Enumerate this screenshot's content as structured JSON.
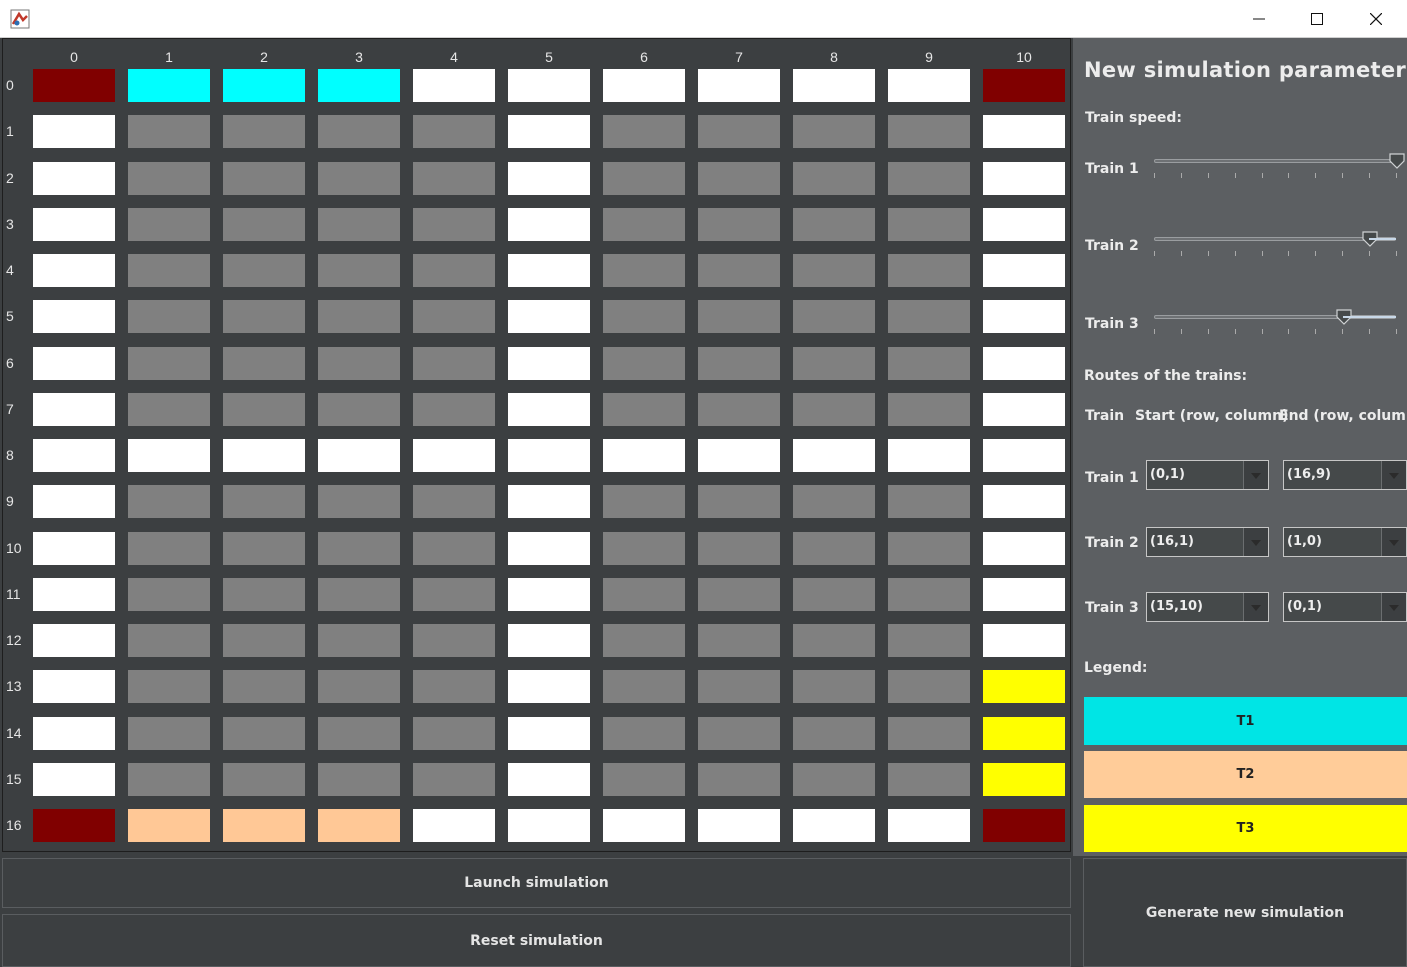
{
  "window": {
    "app_icon": "java-app-icon",
    "minimize_icon": "minimize-icon",
    "maximize_icon": "maximize-icon",
    "close_icon": "close-icon"
  },
  "grid": {
    "columns": [
      "0",
      "1",
      "2",
      "3",
      "4",
      "5",
      "6",
      "7",
      "8",
      "9",
      "10"
    ],
    "rows": [
      "0",
      "1",
      "2",
      "3",
      "4",
      "5",
      "6",
      "7",
      "8",
      "9",
      "10",
      "11",
      "12",
      "13",
      "14",
      "15",
      "16"
    ],
    "colors": {
      "W": "#ffffff",
      "G": "#808080",
      "R": "#800000",
      "C": "#00ffff",
      "P": "#ffc896",
      "Y": "#ffff00"
    },
    "cells": [
      "RCCCWWWWWWR",
      "WGGGGWGGGGW",
      "WGGGGWGGGGW",
      "WGGGGWGGGGW",
      "WGGGGWGGGGW",
      "WGGGGWGGGGW",
      "WGGGGWGGGGW",
      "WGGGGWGGGGW",
      "WWWWWWWWWWW",
      "WGGGGWGGGGW",
      "WGGGGWGGGGW",
      "WGGGGWGGGGW",
      "WGGGGWGGGGW",
      "WGGGGWGGGGY",
      "WGGGGWGGGGY",
      "WGGGGWGGGGY",
      "RPPPWWWWWWR"
    ]
  },
  "panel": {
    "title": "New simulation parameters",
    "speed_label": "Train speed:",
    "sliders": [
      {
        "label": "Train 1",
        "value": 1.0
      },
      {
        "label": "Train 2",
        "value": 0.89
      },
      {
        "label": "Train 3",
        "value": 0.78
      }
    ],
    "routes_label": "Routes of the trains:",
    "route_headers": {
      "train": "Train",
      "start": "Start (row, column)",
      "end": "End (row, column)"
    },
    "routes": [
      {
        "label": "Train 1",
        "start": "(0,1)",
        "end": "(16,9)"
      },
      {
        "label": "Train 2",
        "start": "(16,1)",
        "end": "(1,0)"
      },
      {
        "label": "Train 3",
        "start": "(15,10)",
        "end": "(0,1)"
      }
    ],
    "legend_label": "Legend:",
    "legend": [
      {
        "label": "T1",
        "color": "#00e5e5"
      },
      {
        "label": "T2",
        "color": "#ffcc99"
      },
      {
        "label": "T3",
        "color": "#ffff00"
      }
    ]
  },
  "buttons": {
    "launch": "Launch simulation",
    "reset": "Reset simulation",
    "generate": "Generate new simulation"
  }
}
